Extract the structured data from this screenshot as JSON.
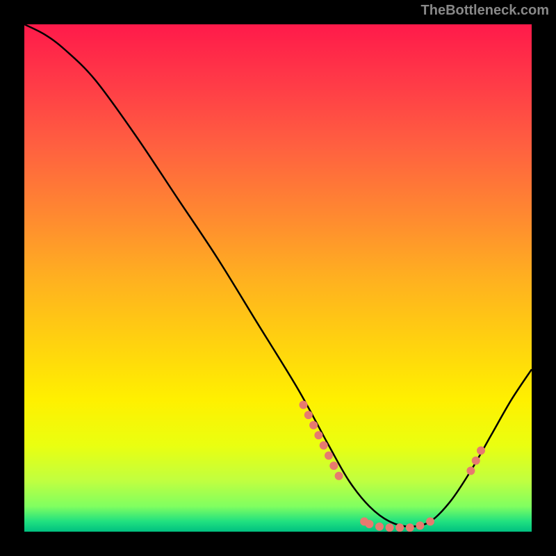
{
  "attribution": "TheBottleneck.com",
  "chart_data": {
    "type": "line",
    "title": "",
    "xlabel": "",
    "ylabel": "",
    "xlim": [
      0,
      100
    ],
    "ylim": [
      0,
      100
    ],
    "curve": {
      "x": [
        0,
        4,
        8,
        14,
        22,
        30,
        38,
        46,
        54,
        60,
        64,
        68,
        72,
        76,
        80,
        84,
        88,
        92,
        96,
        100
      ],
      "y": [
        100,
        98,
        95,
        89,
        78,
        66,
        54,
        41,
        28,
        17,
        10,
        5,
        2,
        1,
        2,
        6,
        12,
        19,
        26,
        32
      ]
    },
    "markers": [
      {
        "x": 55,
        "y": 25
      },
      {
        "x": 56,
        "y": 23
      },
      {
        "x": 57,
        "y": 21
      },
      {
        "x": 58,
        "y": 19
      },
      {
        "x": 59,
        "y": 17
      },
      {
        "x": 60,
        "y": 15
      },
      {
        "x": 61,
        "y": 13
      },
      {
        "x": 62,
        "y": 11
      },
      {
        "x": 67,
        "y": 2
      },
      {
        "x": 68,
        "y": 1.5
      },
      {
        "x": 70,
        "y": 1
      },
      {
        "x": 72,
        "y": 0.8
      },
      {
        "x": 74,
        "y": 0.8
      },
      {
        "x": 76,
        "y": 0.8
      },
      {
        "x": 78,
        "y": 1.2
      },
      {
        "x": 80,
        "y": 2
      },
      {
        "x": 88,
        "y": 12
      },
      {
        "x": 89,
        "y": 14
      },
      {
        "x": 90,
        "y": 16
      }
    ],
    "marker_color": "#e77a6f"
  }
}
